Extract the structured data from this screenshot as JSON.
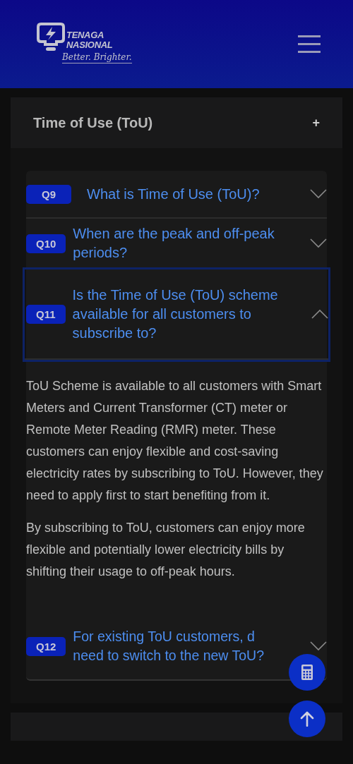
{
  "header": {
    "logo_line_1": "TENAGA",
    "logo_line_2": "NASIONAL",
    "tagline": "Better. Brighter."
  },
  "section": {
    "title": "Time of Use (ToU)",
    "toggle": "+"
  },
  "faqs": [
    {
      "number": "Q9",
      "question": "What is Time of Use (ToU)?",
      "expanded": false
    },
    {
      "number": "Q10",
      "question": "When are the peak and off-peak periods?",
      "expanded": false
    },
    {
      "number": "Q11",
      "question": "Is the Time of Use (ToU) scheme available for all customers to subscribe to?",
      "expanded": true,
      "answer": [
        "ToU Scheme is available to all customers with Smart Meters and Current Transformer (CT) meter or Remote Meter Reading (RMR) meter. These customers can enjoy flexible and cost-saving electricity rates by subscribing to ToU. However, they need to apply first to start benefiting from it.",
        "By subscribing to ToU, customers can enjoy more flexible and potentially lower electricity bills by shifting their usage to off-peak hours."
      ]
    },
    {
      "number": "Q12",
      "question": "For existing ToU customers, d need to switch to the new ToU?",
      "expanded": false
    }
  ]
}
